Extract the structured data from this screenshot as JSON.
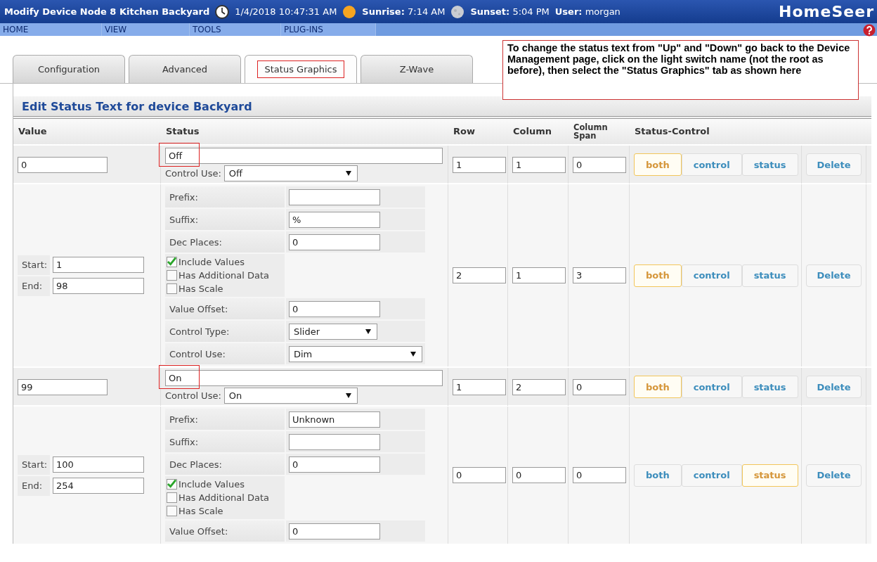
{
  "header": {
    "title": "Modify Device Node 8 Kitchen Backyard",
    "datetime": "1/4/2018 10:47:31 AM",
    "sunrise": "**Sunrise:** 7:14 AM",
    "sunset": "**Sunset:** 5:04 PM",
    "user": "**User:** morgan",
    "logo": "HomeSeer"
  },
  "nav": [
    "HOME",
    "VIEW",
    "TOOLS",
    "PLUG-INS"
  ],
  "tabs": [
    {
      "label": "Configuration",
      "selected": false,
      "highlighted": false
    },
    {
      "label": "Advanced",
      "selected": false,
      "highlighted": false
    },
    {
      "label": "Status Graphics",
      "selected": true,
      "highlighted": true
    },
    {
      "label": "Z-Wave",
      "selected": false,
      "highlighted": false
    }
  ],
  "callout": "To change the status text from \"Up\" and \"Down\" go back to the Device Management page, click on the light switch name (not the root as before), then select the \"Status Graphics\" tab as shown here",
  "section_title": "Edit Status Text for device Backyard",
  "columns": [
    "Value",
    "Status",
    "Row",
    "Column",
    "Column Span",
    "Status-Control"
  ],
  "rows": [
    {
      "kind": "single",
      "value": "0",
      "status": "Off",
      "highlighted": true,
      "control_use_label": "Control Use:",
      "control_use": "Off",
      "row": "1",
      "column": "1",
      "span": "0",
      "modes": [
        {
          "label": "both",
          "selected": true
        },
        {
          "label": "control",
          "selected": false
        },
        {
          "label": "status",
          "selected": false
        }
      ],
      "delete": "Delete"
    },
    {
      "kind": "range",
      "start_label": "Start:",
      "start": "1",
      "end_label": "End:",
      "end": "98",
      "fields": [
        {
          "kind": "input",
          "label": "Prefix:"
        },
        {
          "kind": "input",
          "label": "Suffix:",
          "value": "%"
        },
        {
          "kind": "input",
          "label": "Dec Places:",
          "value": "0"
        },
        {
          "kind": "checks",
          "items": [
            {
              "label": "Include Values",
              "checked": true
            },
            {
              "label": "Has Additional Data",
              "checked": false
            },
            {
              "label": "Has Scale",
              "checked": false
            }
          ]
        },
        {
          "kind": "input",
          "label": "Value Offset:",
          "value": "0"
        },
        {
          "kind": "select",
          "label": "Control Type:",
          "value": "Slider"
        },
        {
          "kind": "wideselect",
          "label": "Control Use:",
          "value": "Dim"
        }
      ],
      "row": "2",
      "column": "1",
      "span": "3",
      "modes": [
        {
          "label": "both",
          "selected": true
        },
        {
          "label": "control",
          "selected": false
        },
        {
          "label": "status",
          "selected": false
        }
      ],
      "delete": "Delete"
    },
    {
      "kind": "single",
      "value": "99",
      "status": "On",
      "highlighted": true,
      "control_use_label": "Control Use:",
      "control_use": "On",
      "row": "1",
      "column": "2",
      "span": "0",
      "modes": [
        {
          "label": "both",
          "selected": true
        },
        {
          "label": "control",
          "selected": false
        },
        {
          "label": "status",
          "selected": false
        }
      ],
      "delete": "Delete"
    },
    {
      "kind": "range",
      "start_label": "Start:",
      "start": "100",
      "end_label": "End:",
      "end": "254",
      "fields": [
        {
          "kind": "input",
          "label": "Prefix:",
          "value": "Unknown"
        },
        {
          "kind": "input",
          "label": "Suffix:"
        },
        {
          "kind": "input",
          "label": "Dec Places:",
          "value": "0"
        },
        {
          "kind": "checks",
          "items": [
            {
              "label": "Include Values",
              "checked": true
            },
            {
              "label": "Has Additional Data",
              "checked": false
            },
            {
              "label": "Has Scale",
              "checked": false
            }
          ]
        },
        {
          "kind": "input",
          "label": "Value Offset:",
          "value": "0"
        }
      ],
      "row": "0",
      "column": "0",
      "span": "0",
      "modes": [
        {
          "label": "both",
          "selected": false
        },
        {
          "label": "control",
          "selected": false
        },
        {
          "label": "status",
          "selected": true
        }
      ],
      "delete": "Delete"
    }
  ]
}
